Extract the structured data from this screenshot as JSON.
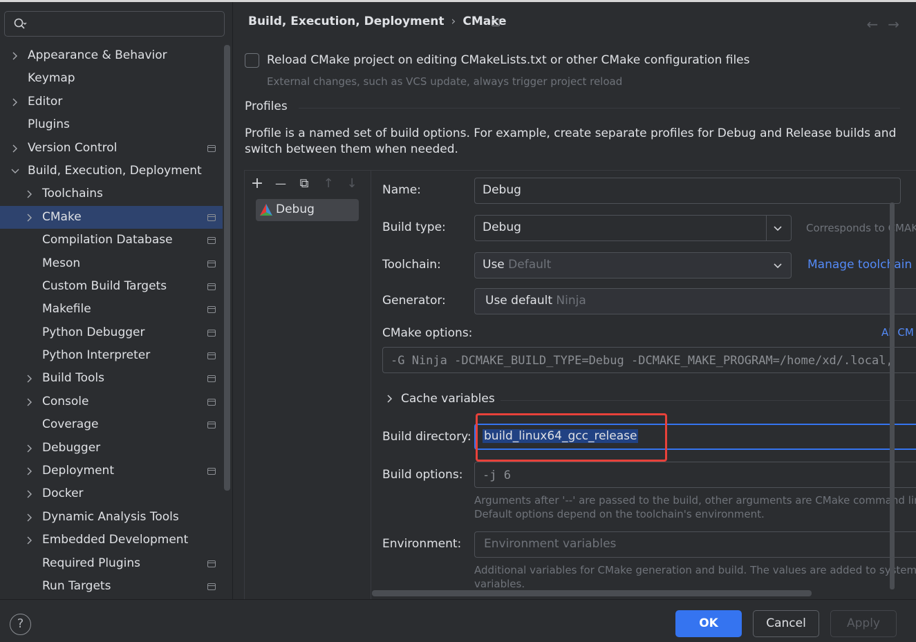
{
  "search": {
    "placeholder": ""
  },
  "tree": [
    {
      "label": "Appearance & Behavior",
      "level": 0,
      "expandable": true,
      "expanded": false,
      "page_icon": false,
      "selected": false
    },
    {
      "label": "Keymap",
      "level": 0,
      "expandable": false,
      "expanded": false,
      "page_icon": false,
      "selected": false
    },
    {
      "label": "Editor",
      "level": 0,
      "expandable": true,
      "expanded": false,
      "page_icon": false,
      "selected": false
    },
    {
      "label": "Plugins",
      "level": 0,
      "expandable": false,
      "expanded": false,
      "page_icon": false,
      "selected": false
    },
    {
      "label": "Version Control",
      "level": 0,
      "expandable": true,
      "expanded": false,
      "page_icon": true,
      "selected": false
    },
    {
      "label": "Build, Execution, Deployment",
      "level": 0,
      "expandable": true,
      "expanded": true,
      "page_icon": false,
      "selected": false
    },
    {
      "label": "Toolchains",
      "level": 1,
      "expandable": true,
      "expanded": false,
      "page_icon": false,
      "selected": false
    },
    {
      "label": "CMake",
      "level": 1,
      "expandable": true,
      "expanded": false,
      "page_icon": true,
      "selected": true
    },
    {
      "label": "Compilation Database",
      "level": 1,
      "expandable": false,
      "expanded": false,
      "page_icon": true,
      "selected": false
    },
    {
      "label": "Meson",
      "level": 1,
      "expandable": false,
      "expanded": false,
      "page_icon": true,
      "selected": false
    },
    {
      "label": "Custom Build Targets",
      "level": 1,
      "expandable": false,
      "expanded": false,
      "page_icon": true,
      "selected": false
    },
    {
      "label": "Makefile",
      "level": 1,
      "expandable": false,
      "expanded": false,
      "page_icon": true,
      "selected": false
    },
    {
      "label": "Python Debugger",
      "level": 1,
      "expandable": false,
      "expanded": false,
      "page_icon": true,
      "selected": false
    },
    {
      "label": "Python Interpreter",
      "level": 1,
      "expandable": false,
      "expanded": false,
      "page_icon": true,
      "selected": false
    },
    {
      "label": "Build Tools",
      "level": 1,
      "expandable": true,
      "expanded": false,
      "page_icon": true,
      "selected": false
    },
    {
      "label": "Console",
      "level": 1,
      "expandable": true,
      "expanded": false,
      "page_icon": true,
      "selected": false
    },
    {
      "label": "Coverage",
      "level": 1,
      "expandable": false,
      "expanded": false,
      "page_icon": true,
      "selected": false
    },
    {
      "label": "Debugger",
      "level": 1,
      "expandable": true,
      "expanded": false,
      "page_icon": false,
      "selected": false
    },
    {
      "label": "Deployment",
      "level": 1,
      "expandable": true,
      "expanded": false,
      "page_icon": true,
      "selected": false
    },
    {
      "label": "Docker",
      "level": 1,
      "expandable": true,
      "expanded": false,
      "page_icon": false,
      "selected": false
    },
    {
      "label": "Dynamic Analysis Tools",
      "level": 1,
      "expandable": true,
      "expanded": false,
      "page_icon": false,
      "selected": false
    },
    {
      "label": "Embedded Development",
      "level": 1,
      "expandable": true,
      "expanded": false,
      "page_icon": false,
      "selected": false
    },
    {
      "label": "Required Plugins",
      "level": 1,
      "expandable": false,
      "expanded": false,
      "page_icon": true,
      "selected": false
    },
    {
      "label": "Run Targets",
      "level": 1,
      "expandable": false,
      "expanded": false,
      "page_icon": true,
      "selected": false
    }
  ],
  "breadcrumb": {
    "parent": "Build, Execution, Deployment",
    "separator": "›",
    "current": "CMake"
  },
  "nav": {
    "back": "←",
    "forward": "→"
  },
  "reload": {
    "label": "Reload CMake project on editing CMakeLists.txt or other CMake configuration files",
    "hint": "External changes, such as VCS update, always trigger project reload",
    "checked": false
  },
  "profiles": {
    "title": "Profiles",
    "description": "Profile is a named set of build options. For example, create separate profiles for Debug and Release builds and switch between them when needed.",
    "toolbar": {
      "add": "+",
      "remove": "—",
      "copy": "⧉",
      "up": "↑",
      "down": "↓"
    },
    "items": [
      "Debug"
    ]
  },
  "form": {
    "name_label": "Name:",
    "name_value": "Debug",
    "build_type_label": "Build type:",
    "build_type_value": "Debug",
    "build_type_hint": "Corresponds to CMAK",
    "toolchain_label": "Toolchain:",
    "toolchain_use": "Use",
    "toolchain_default": "Default",
    "manage_toolchains": "Manage toolchain",
    "generator_label": "Generator:",
    "generator_use": "Use default",
    "generator_default": "Ninja",
    "cmake_options_label": "CMake options:",
    "cmake_options_link": "All CM",
    "cmake_options_value": "-G Ninja -DCMAKE_BUILD_TYPE=Debug -DCMAKE_MAKE_PROGRAM=/home/xd/.local,",
    "cache_variables": "Cache variables",
    "build_dir_label": "Build directory:",
    "build_dir_value": "build_linux64_gcc_release",
    "build_options_label": "Build options:",
    "build_options_value": "-j 6",
    "build_options_hint1": "Arguments after '--' are passed to the build, other arguments are CMake command lin",
    "build_options_hint2": "Default options depend on the toolchain's environment.",
    "environment_label": "Environment:",
    "environment_placeholder": "Environment variables",
    "environment_hint1": "Additional variables for CMake generation and build. The values are added to system",
    "environment_hint2": "variables."
  },
  "buttons": {
    "help": "?",
    "ok": "OK",
    "cancel": "Cancel",
    "apply": "Apply"
  },
  "colors": {
    "accent": "#3574f0",
    "highlight": "#e8413a",
    "selection": "#2e436e",
    "link": "#548af7"
  }
}
